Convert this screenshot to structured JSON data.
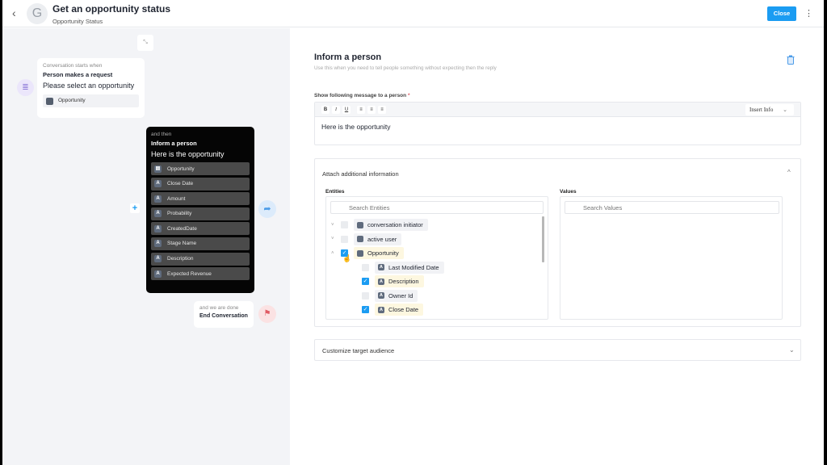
{
  "header": {
    "avatar_letter": "G",
    "title": "Get an opportunity status",
    "subtitle": "Opportunity Status",
    "close_label": "Close",
    "back_glyph": "‹",
    "more_glyph": "⋮"
  },
  "flow": {
    "collapse_glyph": "⤡",
    "start": {
      "caption": "Conversation starts when",
      "trigger": "Person makes a request",
      "message": "Please select an opportunity",
      "chip": "Opportunity"
    },
    "step": {
      "caption": "and then",
      "action": "Inform a person",
      "message": "Here is the opportunity",
      "items": [
        {
          "icon": "table-icon",
          "glyph": "▤",
          "label": "Opportunity"
        },
        {
          "icon": "text-field-icon",
          "glyph": "A",
          "label": "Close Date"
        },
        {
          "icon": "text-field-icon",
          "glyph": "A",
          "label": "Amount"
        },
        {
          "icon": "text-field-icon",
          "glyph": "A",
          "label": "Probability"
        },
        {
          "icon": "text-field-icon",
          "glyph": "A",
          "label": "CreatedDate"
        },
        {
          "icon": "text-field-icon",
          "glyph": "A",
          "label": "Stage Name"
        },
        {
          "icon": "text-field-icon",
          "glyph": "A",
          "label": "Description"
        },
        {
          "icon": "text-field-icon",
          "glyph": "A",
          "label": "Expected Revenue"
        }
      ]
    },
    "add_glyph": "+",
    "share_glyph": "➦",
    "end": {
      "caption": "and we are done",
      "action": "End Conversation"
    },
    "flag_glyph": "⚑"
  },
  "panel": {
    "title": "Inform a person",
    "description": "Use this when you need to tell people something without expecting then the reply",
    "message_label": "Show following message to a person",
    "required_mark": "*",
    "toolbar": {
      "bold": "B",
      "italic": "I",
      "underline": "U",
      "align_left": "≡",
      "align_center": "≡",
      "align_right": "≡",
      "insert_info": "Insert Info",
      "insert_chevron": "⌄"
    },
    "message_text": "Here is the opportunity",
    "attach": {
      "title": "Attach additional information",
      "chevron": "^",
      "entities_label": "Entities",
      "entities_search_placeholder": "Search Entities",
      "values_label": "Values",
      "values_search_placeholder": "Search Values",
      "search_glyph": "⌕",
      "tree": [
        {
          "label": "conversation initiator",
          "checked": false,
          "expanded": false,
          "level": 0,
          "selected": false
        },
        {
          "label": "active user",
          "checked": false,
          "expanded": false,
          "level": 0,
          "selected": false
        },
        {
          "label": "Opportunity",
          "checked": true,
          "expanded": true,
          "level": 0,
          "selected": true
        },
        {
          "label": "Last Modified Date",
          "checked": false,
          "level": 1,
          "selected": false
        },
        {
          "label": "Description",
          "checked": true,
          "level": 1,
          "selected": true
        },
        {
          "label": "Owner Id",
          "checked": false,
          "level": 1,
          "selected": false
        },
        {
          "label": "Close Date",
          "checked": true,
          "level": 1,
          "selected": true
        }
      ]
    },
    "target": {
      "title": "Customize target audience",
      "chevron": "⌄"
    }
  },
  "colors": {
    "accent": "#1b9cf2",
    "dark_card": "#050505",
    "selected_tag": "#fdf7e0",
    "danger": "#e05b64"
  }
}
